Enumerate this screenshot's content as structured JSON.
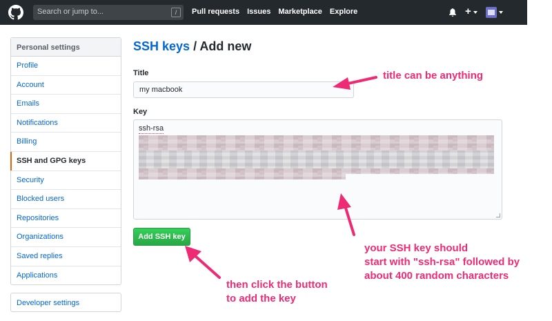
{
  "header": {
    "search_placeholder": "Search or jump to...",
    "search_shortcut": "/",
    "nav": [
      "Pull requests",
      "Issues",
      "Marketplace",
      "Explore"
    ],
    "plus": "+"
  },
  "sidebar": {
    "heading": "Personal settings",
    "items": [
      {
        "label": "Profile"
      },
      {
        "label": "Account"
      },
      {
        "label": "Emails"
      },
      {
        "label": "Notifications"
      },
      {
        "label": "Billing"
      },
      {
        "label": "SSH and GPG keys",
        "active": true
      },
      {
        "label": "Security"
      },
      {
        "label": "Blocked users"
      },
      {
        "label": "Repositories"
      },
      {
        "label": "Organizations"
      },
      {
        "label": "Saved replies"
      },
      {
        "label": "Applications"
      }
    ],
    "developer_settings": "Developer settings"
  },
  "main": {
    "breadcrumb_link": "SSH keys",
    "breadcrumb_rest": " / Add new",
    "title_label": "Title",
    "title_value": "my macbook",
    "key_label": "Key",
    "key_prefix": "ssh-rsa",
    "add_button": "Add SSH key"
  },
  "annotations": {
    "title_note": "title can be anything",
    "key_note_1": "your SSH key should",
    "key_note_2": "start with \"ssh-rsa\" followed by",
    "key_note_3": "about 400 random characters",
    "button_note_1": "then click the button",
    "button_note_2": "to add the key"
  },
  "colors": {
    "header_bg": "#24292e",
    "link": "#0366d6",
    "active_marker": "#e36209",
    "button_green": "#28a745",
    "annotation_pink": "#ee2a74"
  }
}
